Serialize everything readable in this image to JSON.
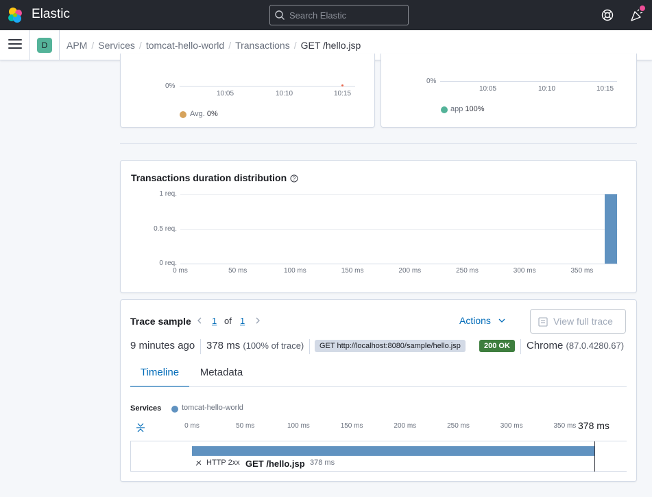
{
  "header": {
    "brand": "Elastic",
    "search_placeholder": "Search Elastic"
  },
  "nav": {
    "space_letter": "D",
    "breadcrumbs": [
      "APM",
      "Services",
      "tomcat-hello-world",
      "Transactions",
      "GET /hello.jsp"
    ]
  },
  "chart_left": {
    "y_tick": "0%",
    "x_ticks": [
      "10:05",
      "10:10",
      "10:15"
    ],
    "legend_label": "Avg.",
    "legend_value": "0%",
    "legend_color": "#d6a35c"
  },
  "chart_right": {
    "y_tick": "0%",
    "x_ticks": [
      "10:05",
      "10:10",
      "10:15"
    ],
    "legend_label": "app",
    "legend_value": "100%",
    "legend_color": "#54b399"
  },
  "distribution": {
    "title": "Transactions duration distribution",
    "bar_color": "#6092c0"
  },
  "chart_data": {
    "type": "bar",
    "title": "Transactions duration distribution",
    "x_ticks": [
      "0 ms",
      "50 ms",
      "100 ms",
      "150 ms",
      "200 ms",
      "250 ms",
      "300 ms",
      "350 ms"
    ],
    "y_ticks": [
      "1 req.",
      "0.5 req.",
      "0 req."
    ],
    "xlim": [
      0,
      380
    ],
    "ylim": [
      0,
      1
    ],
    "bars": [
      {
        "x_start": 370,
        "x_end": 380,
        "value": 1
      }
    ],
    "grid": true
  },
  "trace": {
    "title": "Trace sample",
    "page_current": "1",
    "page_of": "of",
    "page_total": "1",
    "actions_label": "Actions",
    "view_full_trace_label": "View full trace",
    "time_ago": "9 minutes ago",
    "duration": "378 ms",
    "duration_pct": "(100% of trace)",
    "url_badge": "GET http://localhost:8080/sample/hello.jsp",
    "status_badge": "200 OK",
    "status_color": "#3e7e3e",
    "browser": "Chrome",
    "browser_version": "(87.0.4280.67)",
    "tabs": [
      "Timeline",
      "Metadata"
    ],
    "services_label": "Services",
    "service_name": "tomcat-hello-world",
    "service_color": "#6092c0",
    "timeline_ticks": [
      "0 ms",
      "50 ms",
      "100 ms",
      "150 ms",
      "200 ms",
      "250 ms",
      "300 ms",
      "350 ms"
    ],
    "timeline_total": "378 ms",
    "span_status": "HTTP 2xx",
    "span_name": "GET /hello.jsp",
    "span_duration": "378 ms",
    "span_fraction": 1.0
  }
}
